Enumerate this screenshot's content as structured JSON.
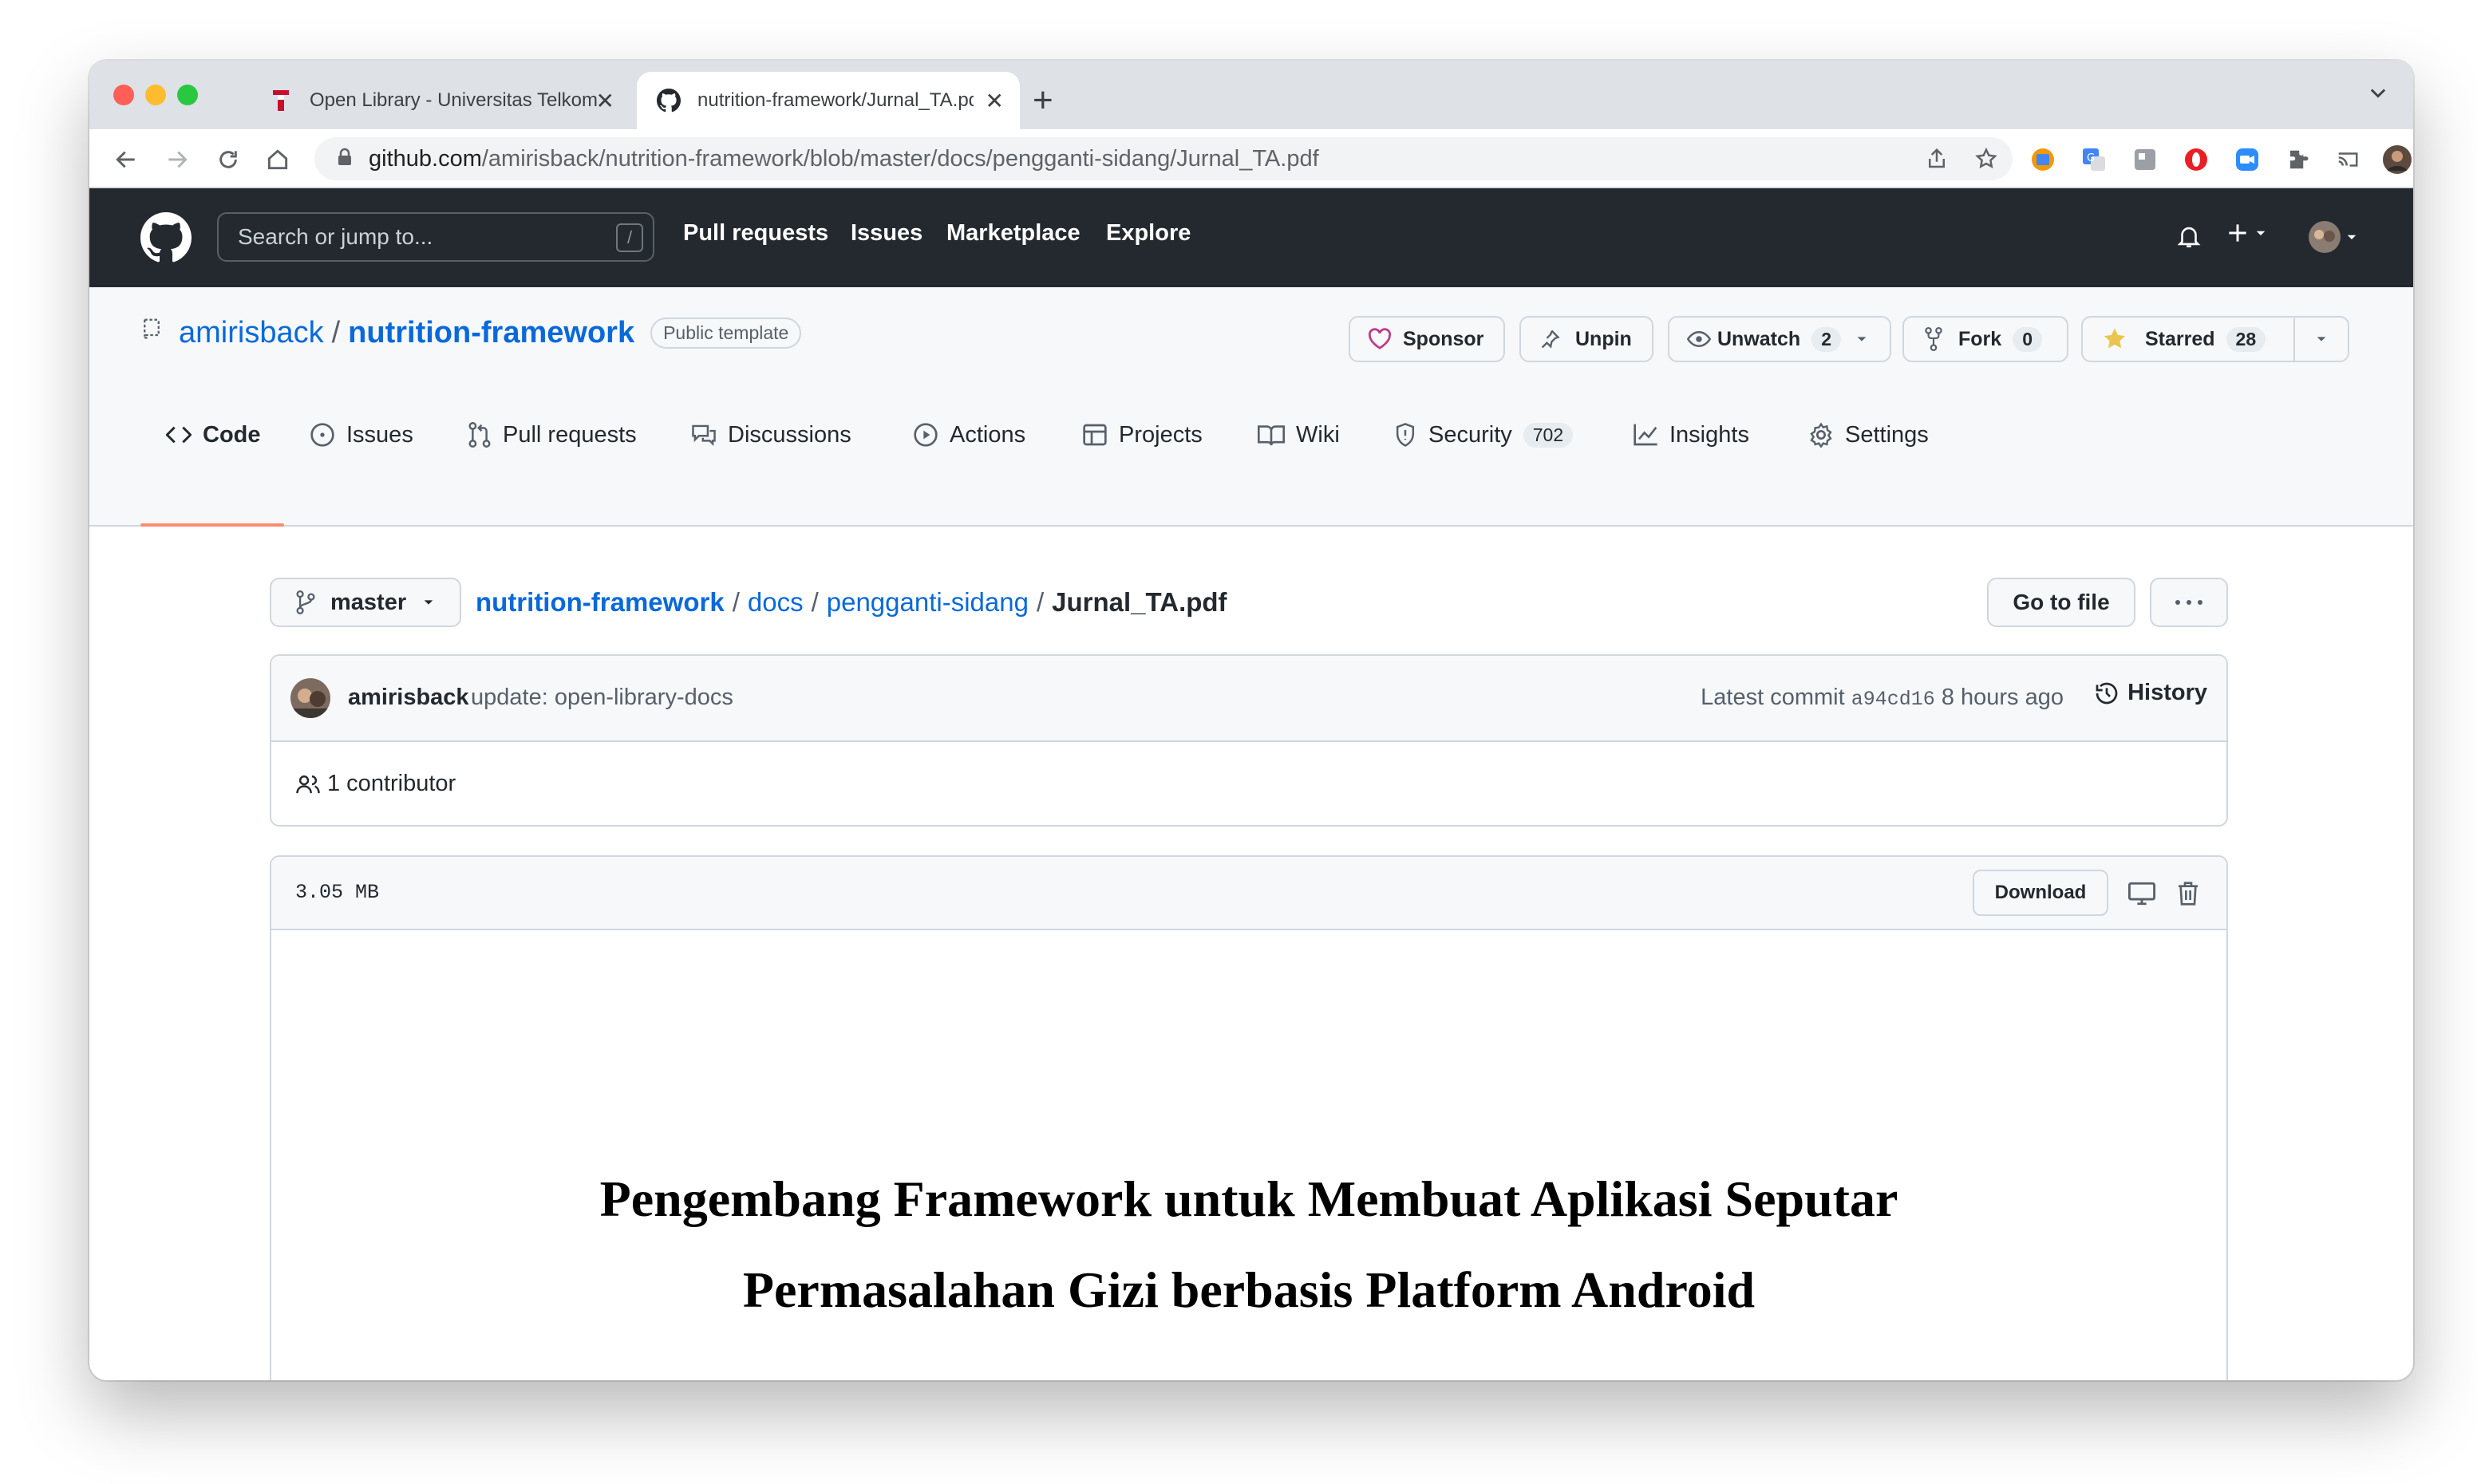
{
  "browser": {
    "tabs": [
      {
        "title": "Open Library - Universitas Telkom",
        "active": false
      },
      {
        "title": "nutrition-framework/Jurnal_TA.pdf",
        "active": true
      }
    ],
    "url_host": "github.com",
    "url_path": "/amirisback/nutrition-framework/blob/master/docs/pengganti-sidang/Jurnal_TA.pdf"
  },
  "github": {
    "search_placeholder": "Search or jump to...",
    "search_shortcut": "/",
    "nav": [
      "Pull requests",
      "Issues",
      "Marketplace",
      "Explore"
    ]
  },
  "repo": {
    "owner": "amirisback",
    "separator": "/",
    "name": "nutrition-framework",
    "visibility": "Public template",
    "actions": {
      "sponsor": "Sponsor",
      "unpin": "Unpin",
      "unwatch": "Unwatch",
      "watch_count": "2",
      "fork": "Fork",
      "fork_count": "0",
      "starred": "Starred",
      "star_count": "28"
    },
    "tabs": [
      {
        "label": "Code",
        "icon": "code-icon",
        "active": true
      },
      {
        "label": "Issues",
        "icon": "issue-icon"
      },
      {
        "label": "Pull requests",
        "icon": "pull-request-icon"
      },
      {
        "label": "Discussions",
        "icon": "discussion-icon"
      },
      {
        "label": "Actions",
        "icon": "play-icon"
      },
      {
        "label": "Projects",
        "icon": "table-icon"
      },
      {
        "label": "Wiki",
        "icon": "book-icon"
      },
      {
        "label": "Security",
        "icon": "shield-icon",
        "count": "702"
      },
      {
        "label": "Insights",
        "icon": "graph-icon"
      },
      {
        "label": "Settings",
        "icon": "gear-icon"
      }
    ]
  },
  "file": {
    "branch": "master",
    "path": [
      "nutrition-framework",
      "docs",
      "pengganti-sidang"
    ],
    "path_sep": "/",
    "filename": "Jurnal_TA.pdf",
    "go_to_file": "Go to file",
    "commit": {
      "author": "amirisback",
      "message": "update: open-library-docs",
      "latest_label": "Latest commit",
      "sha": "a94cd16",
      "time": "8 hours ago",
      "history": "History"
    },
    "contributors": "1 contributor",
    "size": "3.05 MB",
    "download": "Download",
    "pdf_title_line1": "Pengembang Framework untuk Membuat Aplikasi Seputar",
    "pdf_title_line2": "Permasalahan Gizi berbasis Platform Android"
  },
  "colors": {
    "link": "#0969da",
    "header_bg": "#24292f",
    "active_tab_underline": "#fd8c73",
    "sponsor_heart": "#bf3989",
    "star": "#eac54f"
  }
}
